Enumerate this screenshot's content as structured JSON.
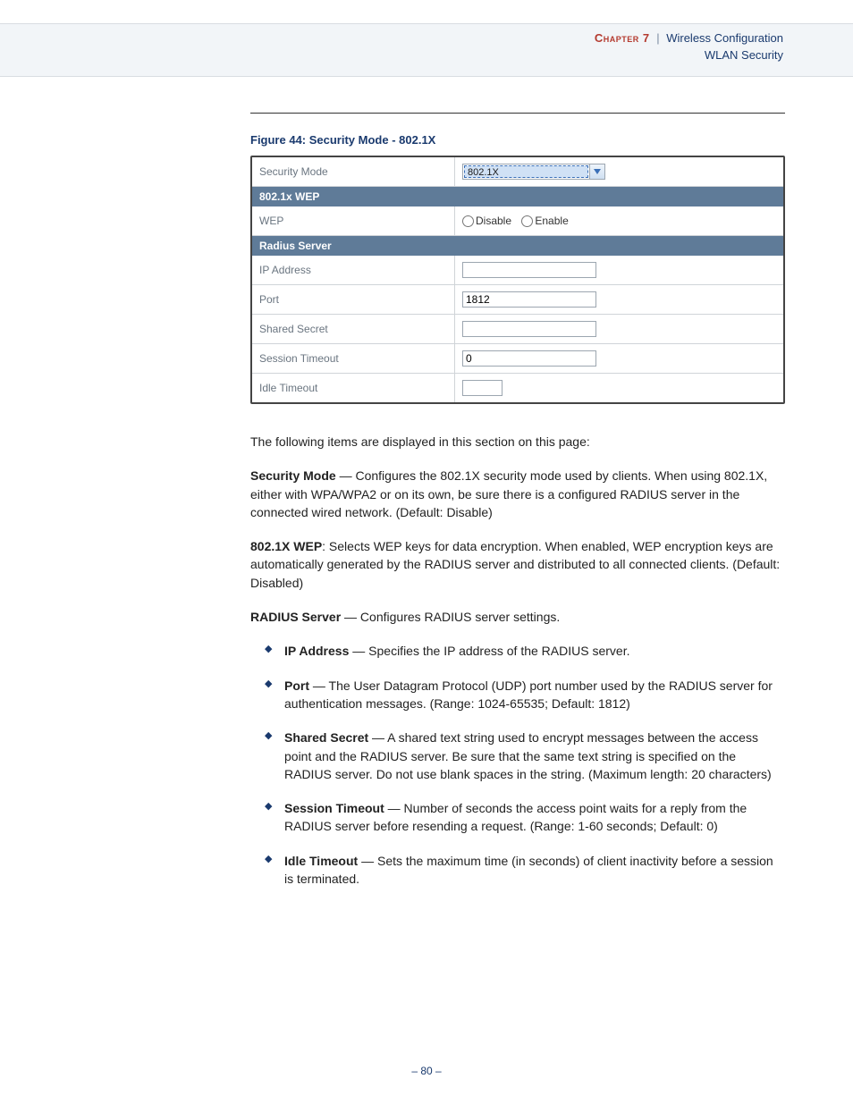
{
  "header": {
    "chapter_label": "Chapter 7",
    "chapter_title": "Wireless Configuration",
    "section": "WLAN Security"
  },
  "figure": {
    "caption": "Figure 44:  Security Mode - 802.1X",
    "rows": {
      "security_mode": {
        "label": "Security Mode",
        "value": "802.1X"
      },
      "section1": "802.1x WEP",
      "wep": {
        "label": "WEP",
        "opt_disable": "Disable",
        "opt_enable": "Enable"
      },
      "section2": "Radius Server",
      "ip": {
        "label": "IP Address",
        "value": ""
      },
      "port": {
        "label": "Port",
        "value": "1812"
      },
      "secret": {
        "label": "Shared Secret",
        "value": ""
      },
      "session": {
        "label": "Session Timeout",
        "value": "0"
      },
      "idle": {
        "label": "Idle Timeout",
        "value": ""
      }
    }
  },
  "body": {
    "intro": "The following items are displayed in this section on this page:",
    "p1": {
      "label": "Security Mode",
      "text": " — Configures the 802.1X security mode used by clients. When using 802.1X, either with WPA/WPA2 or on its own, be sure there is a configured RADIUS server in the connected wired network. (Default: Disable)"
    },
    "p2": {
      "label": "802.1X WEP",
      "text": ": Selects WEP keys for data encryption. When enabled, WEP encryption keys are automatically generated by the RADIUS server and distributed to all connected clients. (Default: Disabled)"
    },
    "p3": {
      "label": "RADIUS Server",
      "text": " — Configures RADIUS server settings."
    },
    "bullets": [
      {
        "label": "IP Address",
        "text": " — Specifies the IP address of the RADIUS server."
      },
      {
        "label": "Port",
        "text": " — The User Datagram Protocol (UDP) port number used by the RADIUS server for authentication messages. (Range: 1024-65535; Default: 1812)"
      },
      {
        "label": "Shared Secret",
        "text": " — A shared text string used to encrypt messages between the access point and the RADIUS server. Be sure that the same text string is specified on the RADIUS server. Do not use blank spaces in the string. (Maximum length: 20 characters)"
      },
      {
        "label": "Session Timeout",
        "text": " — Number of seconds the access point waits for a reply from the RADIUS server before resending a request. (Range: 1-60 seconds; Default: 0)"
      },
      {
        "label": "Idle Timeout",
        "text": " — Sets the maximum time (in seconds) of client inactivity before a session is terminated."
      }
    ]
  },
  "page_number": "–  80  –"
}
